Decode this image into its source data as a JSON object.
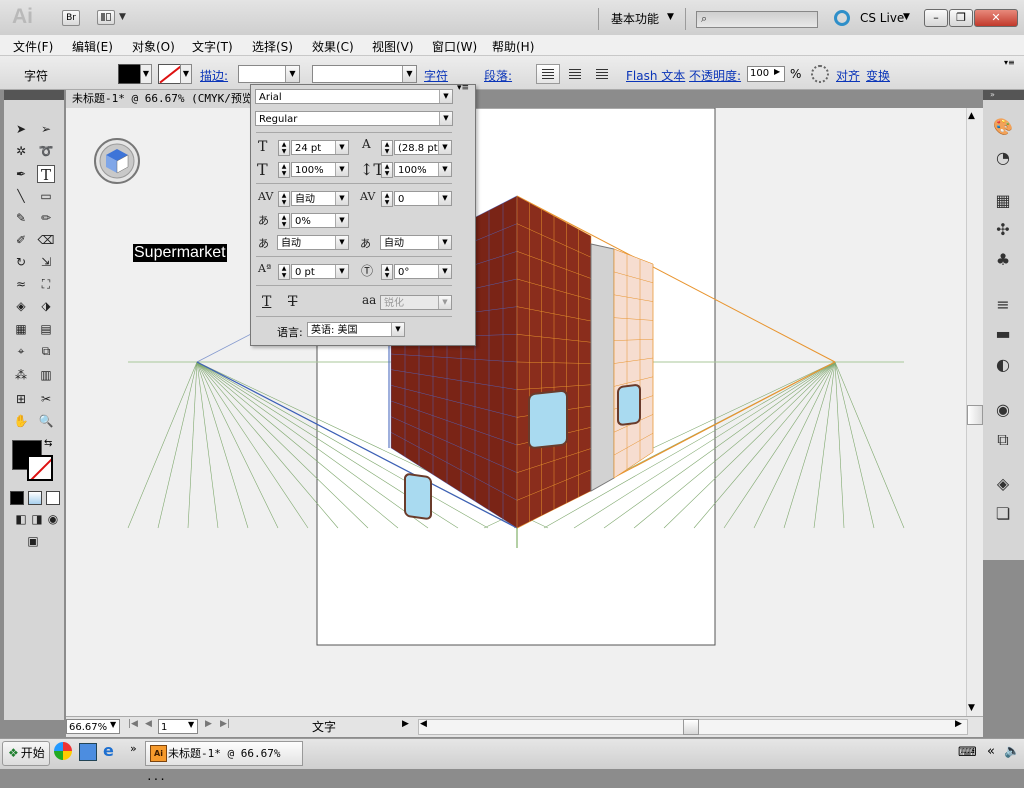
{
  "app": {
    "logo": "Ai",
    "bridge": "Br",
    "workspace": "基本功能",
    "cs_live": "CS Live"
  },
  "menu": [
    "文件(F)",
    "编辑(E)",
    "对象(O)",
    "文字(T)",
    "选择(S)",
    "效果(C)",
    "视图(V)",
    "窗口(W)",
    "帮助(H)"
  ],
  "control": {
    "tool_name": "字符",
    "stroke_label": "描边:",
    "char_link": "字符",
    "para_link": "段落:",
    "flash_link": "Flash 文本",
    "opacity_link": "不透明度:",
    "opacity_value": "100",
    "percent": "%",
    "align_link": "对齐",
    "transform_link": "变换"
  },
  "document": {
    "tab_title": "未标题-1* @ 66.67% (CMYK/预览)",
    "label_text": "Supermarket"
  },
  "char_panel": {
    "font": "Arial",
    "style": "Regular",
    "size": "24 pt",
    "leading": "(28.8 pt)",
    "hscale": "100%",
    "vscale": "100%",
    "kerning": "自动",
    "tracking": "0",
    "tsume": "0%",
    "space_before": "自动",
    "space_after": "自动",
    "baseline_shift": "0 pt",
    "rotation": "0°",
    "antialias_label": "aa",
    "antialias": "锐化",
    "language_label": "语言:",
    "language": "英语: 美国"
  },
  "status": {
    "zoom": "66.67%",
    "page": "1",
    "text": "文字"
  },
  "taskbar": {
    "start": "开始",
    "task_label": "未标题-1* @ 66.67% ..."
  },
  "colors": {
    "building_front": "#7a2416",
    "building_side": "#8a2d1c",
    "grid_orange": "#e8942e",
    "grid_blue": "#3c5fb8",
    "grid_green": "#6a9a5a"
  }
}
